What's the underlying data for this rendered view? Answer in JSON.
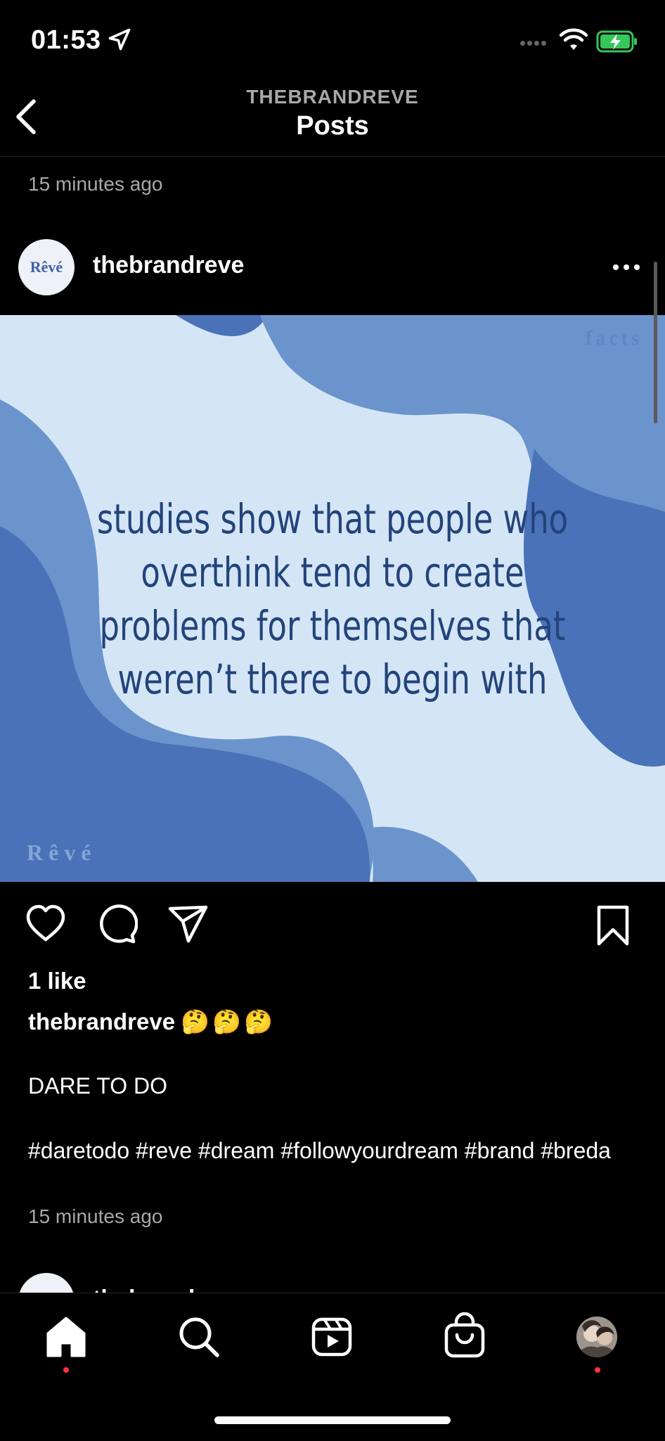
{
  "status_bar": {
    "time": "01:53",
    "icons": [
      "location-arrow-icon",
      "cellular-signal-icon",
      "wifi-icon",
      "battery-charging-icon"
    ]
  },
  "header": {
    "account": "THEBRANDREVE",
    "title": "Posts",
    "back_icon": "chevron-left-icon"
  },
  "previous_post": {
    "timestamp": "15 minutes ago"
  },
  "post": {
    "avatar_text": "Rêvé",
    "username": "thebrandreve",
    "more_icon": "ellipsis-icon",
    "image": {
      "tag": "facts",
      "quote": "studies show that people who overthink tend to create problems for themselves that weren’t there to begin with",
      "watermark": "Rêvé",
      "colors": {
        "light": "#d4e6f6",
        "mid": "#6b94cc",
        "dark": "#4a72b8",
        "text": "#23437a"
      }
    },
    "actions": [
      "heart-icon",
      "comment-icon",
      "paper-plane-icon",
      "bookmark-icon"
    ],
    "likes": "1 like",
    "caption_user": "thebrandreve",
    "caption_emoji": "🤔🤔🤔",
    "caption_text": "DARE TO DO",
    "hashtags": "#daretodo #reve #dream #followyourdream #brand #breda",
    "timestamp": "15 minutes ago"
  },
  "next_post": {
    "username": "thebrandreve"
  },
  "tab_bar": {
    "items": [
      "home-icon",
      "search-icon",
      "reels-icon",
      "shop-icon",
      "profile-avatar"
    ],
    "notification_color": "#ff3040"
  }
}
